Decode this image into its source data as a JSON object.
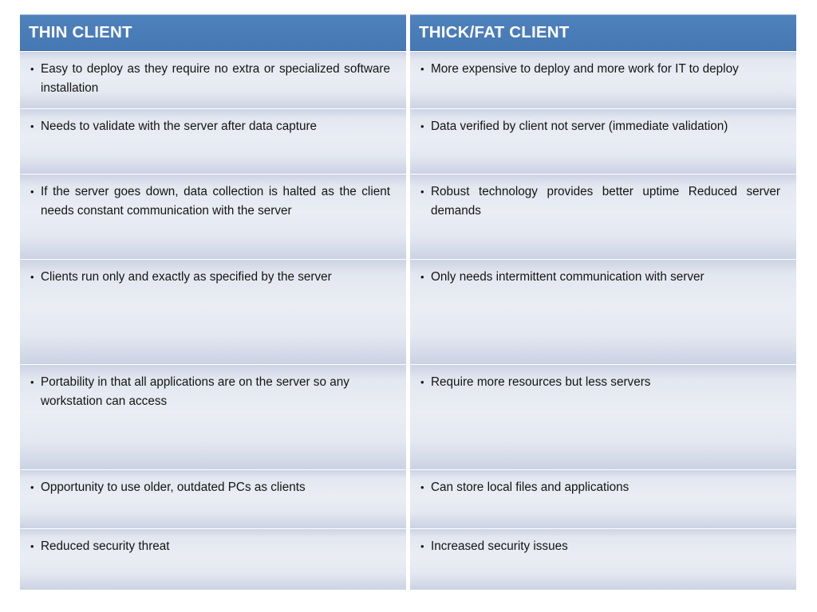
{
  "slide": {
    "title_left": "THIN CLIENT",
    "title_right": "THICK/FAT CLIENT",
    "bullet_glyph": "•",
    "colors": {
      "header_blue": "#4f82bd",
      "header_border": "#3c6da3",
      "cell_light": "#eaedf4",
      "cell_dark": "#ccd3e4",
      "text": "#141414",
      "header_text": "#ffffff",
      "background": "#ffffff"
    }
  },
  "table": {
    "columns": [
      {
        "id": "thin-client",
        "header": "THIN CLIENT"
      },
      {
        "id": "thick-fat-client",
        "header": "THICK/FAT CLIENT"
      }
    ],
    "rows": [
      {
        "left": "Easy to deploy as they require no extra or specialized software installation",
        "right": "More expensive to deploy and more work for IT to deploy"
      },
      {
        "left": "Needs to validate with the server after data capture",
        "right": "Data verified by client not server (immediate validation)"
      },
      {
        "left": "If the server goes down, data collection is halted as the client needs constant communication with the server",
        "right": "Robust technology provides better uptime Reduced server demands"
      },
      {
        "left": "Clients run only and exactly as specified by the server",
        "right": "Only needs intermittent communication with server"
      },
      {
        "left": "Portability in that all applications are on the server so any workstation can access",
        "right": "Require more resources but less servers"
      },
      {
        "left": "Opportunity to use older, outdated PCs as clients",
        "right": "Can store local files and applications"
      },
      {
        "left": "Reduced security threat",
        "right": "Increased security issues"
      }
    ]
  }
}
